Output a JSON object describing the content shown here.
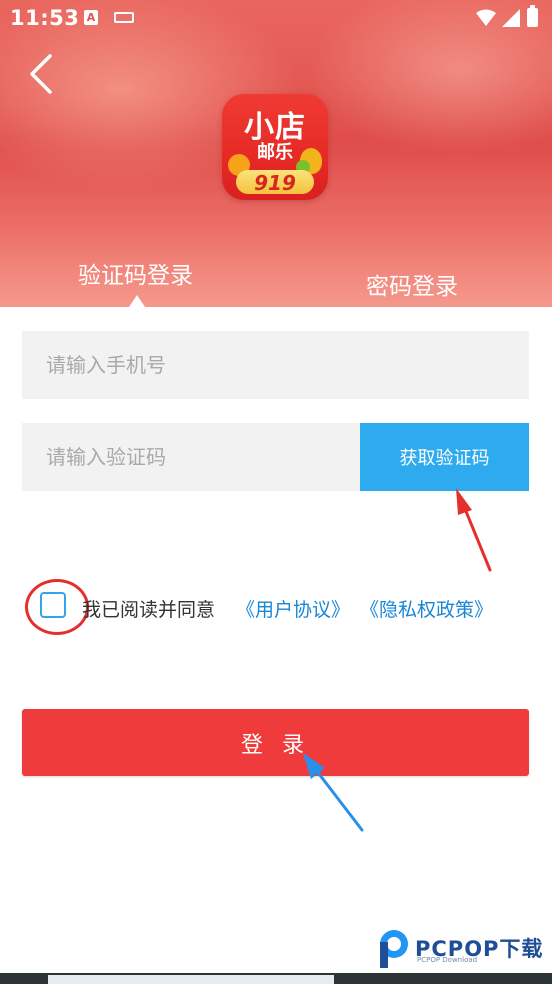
{
  "status_bar": {
    "time": "11:53",
    "notification_icon": "A",
    "icons": [
      "a-badge-icon",
      "keyboard-icon",
      "wifi-icon",
      "signal-icon",
      "battery-icon"
    ]
  },
  "header": {
    "back_icon": "chevron-left-icon",
    "logo": {
      "line1": "小店",
      "line2": "邮乐",
      "number": "919"
    }
  },
  "tabs": [
    {
      "label": "验证码登录",
      "active": true
    },
    {
      "label": "密码登录",
      "active": false
    }
  ],
  "form": {
    "phone_placeholder": "请输入手机号",
    "code_placeholder": "请输入验证码",
    "get_code_label": "获取验证码"
  },
  "agreement": {
    "checked": false,
    "text": "我已阅读并同意",
    "user_agreement": "《用户协议》",
    "privacy_policy": "《隐私权政策》"
  },
  "login_label": "登 录",
  "watermark": {
    "brand": "PCPOP下载",
    "sub": "PCPOP Download"
  },
  "colors": {
    "header": "#e0514d",
    "primary_button": "#ef3b3b",
    "code_button": "#2eaaef",
    "link": "#1a86d6",
    "annotation_red": "#e52f2c",
    "annotation_blue": "#2b8fe8"
  }
}
